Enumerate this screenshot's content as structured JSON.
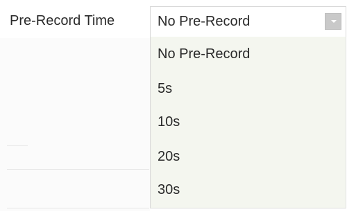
{
  "field": {
    "label": "Pre-Record Time",
    "current_value": "No Pre-Record"
  },
  "dropdown": {
    "options": [
      "No Pre-Record",
      "5s",
      "10s",
      "20s",
      "30s"
    ],
    "selected_index": 0
  },
  "icons": {
    "dropdown_arrow": "chevron-down-icon"
  }
}
